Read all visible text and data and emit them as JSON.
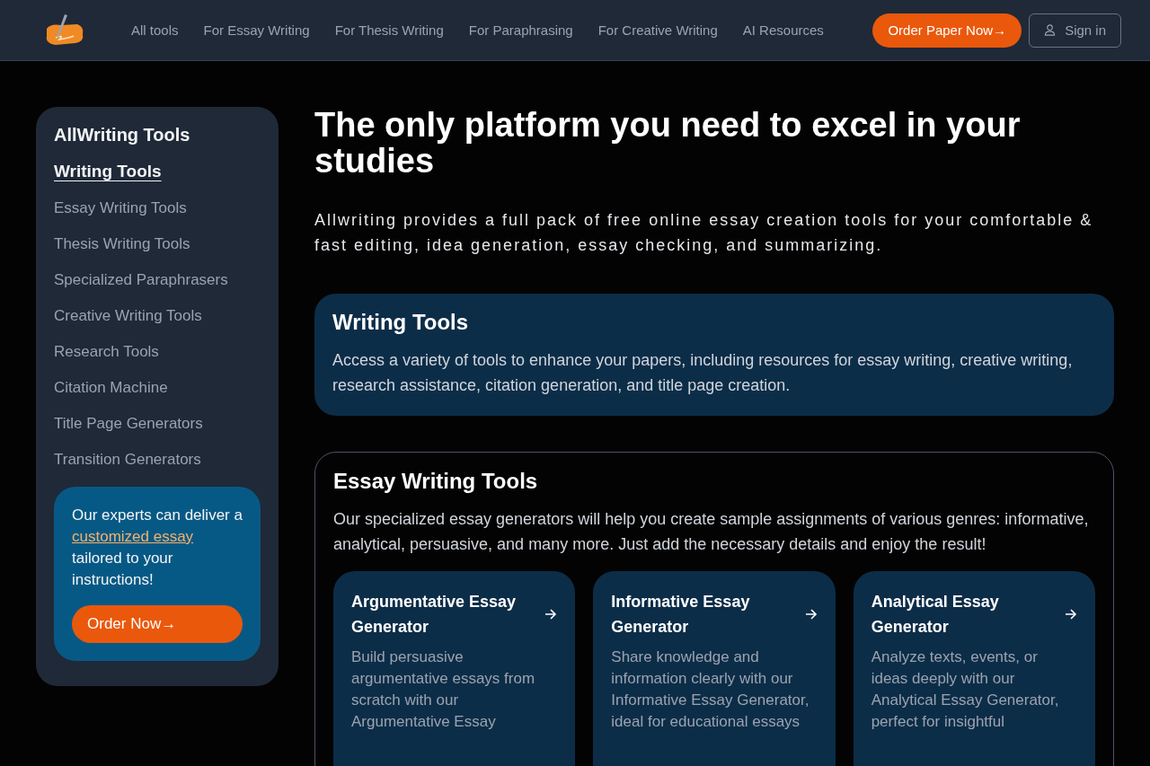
{
  "nav": {
    "links": [
      "All tools",
      "For Essay Writing",
      "For Thesis Writing",
      "For Paraphrasing",
      "For Creative Writing",
      "AI Resources"
    ],
    "order_button": "Order Paper Now→",
    "sign_in": "Sign in"
  },
  "sidebar": {
    "title": "AllWriting Tools",
    "items": [
      {
        "label": "Writing Tools",
        "selected": true
      },
      {
        "label": "Essay Writing Tools",
        "selected": false
      },
      {
        "label": "Thesis Writing Tools",
        "selected": false
      },
      {
        "label": "Specialized Paraphrasers",
        "selected": false
      },
      {
        "label": "Creative Writing Tools",
        "selected": false
      },
      {
        "label": "Research Tools",
        "selected": false
      },
      {
        "label": "Citation Machine",
        "selected": false
      },
      {
        "label": "Title Page Generators",
        "selected": false
      },
      {
        "label": "Transition Generators",
        "selected": false
      }
    ],
    "promo": {
      "text_before": "Our experts can deliver a",
      "link": "customized essay",
      "text_after": "tailored to your instructions!",
      "button": "Order Now→"
    }
  },
  "hero": {
    "title": "The only platform you need to excel in your studies",
    "subtitle": "Allwriting provides a full pack of free online essay creation tools for your comfortable & fast editing, idea generation, essay checking, and summarizing."
  },
  "intro_card": {
    "title": "Writing Tools",
    "text": "Access a variety of tools to enhance your papers, including resources for essay writing, creative writing, research assistance, citation generation, and title page creation."
  },
  "section": {
    "title": "Essay Writing Tools",
    "text": "Our specialized essay generators will help you create sample assignments of various genres: informative, analytical, persuasive, and many more. Just add the necessary details and enjoy the result!",
    "tools": [
      {
        "title": "Argumentative Essay Generator",
        "text": "Build persuasive argumentative essays from scratch with our Argumentative Essay"
      },
      {
        "title": "Informative Essay Generator",
        "text": "Share knowledge and information clearly with our Informative Essay Generator, ideal for educational essays"
      },
      {
        "title": "Analytical Essay Generator",
        "text": "Analyze texts, events, or ideas deeply with our Analytical Essay Generator, perfect for insightful"
      }
    ]
  }
}
